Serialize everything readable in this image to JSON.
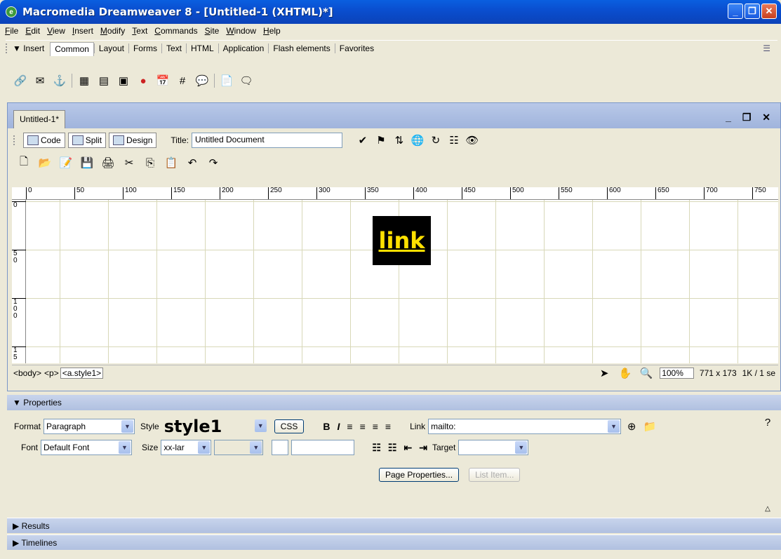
{
  "window": {
    "title": "Macromedia Dreamweaver 8 - [Untitled-1 (XHTML)*]"
  },
  "menu": [
    "File",
    "Edit",
    "View",
    "Insert",
    "Modify",
    "Text",
    "Commands",
    "Site",
    "Window",
    "Help"
  ],
  "insert_bar": {
    "label": "▼ Insert",
    "tabs": [
      "Common",
      "Layout",
      "Forms",
      "Text",
      "HTML",
      "Application",
      "Flash elements",
      "Favorites"
    ],
    "active_tab": "Common",
    "icons": [
      "hyperlink-icon",
      "email-link-icon",
      "named-anchor-icon",
      "table-icon",
      "div-icon",
      "image-icon",
      "media-icon",
      "date-icon",
      "comment-icon",
      "head-icon",
      "template-icon",
      "tag-chooser-icon"
    ]
  },
  "document": {
    "tab": "Untitled-1*",
    "views": [
      "Code",
      "Split",
      "Design"
    ],
    "title_label": "Title:",
    "title_value": "Untitled Document",
    "link_text": "link"
  },
  "ruler": {
    "h": [
      "0",
      "50",
      "100",
      "150",
      "200",
      "250",
      "300",
      "350",
      "400",
      "450",
      "500",
      "550",
      "600",
      "650",
      "700",
      "750"
    ],
    "v": [
      "0",
      "5\n0",
      "1\n0\n0",
      "1\n5"
    ]
  },
  "status": {
    "tags": [
      "<body>",
      "<p>",
      "<a.style1>"
    ],
    "zoom": "100%",
    "size": "771 x 173",
    "weight": "1K / 1 se"
  },
  "properties": {
    "header": "▼ Properties",
    "format_label": "Format",
    "format_value": "Paragraph",
    "style_label": "Style",
    "style_value": "style1",
    "css_button": "CSS",
    "link_label": "Link",
    "link_value": "mailto:",
    "font_label": "Font",
    "font_value": "Default Font",
    "size_label": "Size",
    "size_value": "xx-lar",
    "target_label": "Target",
    "page_properties": "Page Properties...",
    "list_item": "List Item..."
  },
  "panels": [
    "▶ Results",
    "▶ Timelines"
  ]
}
